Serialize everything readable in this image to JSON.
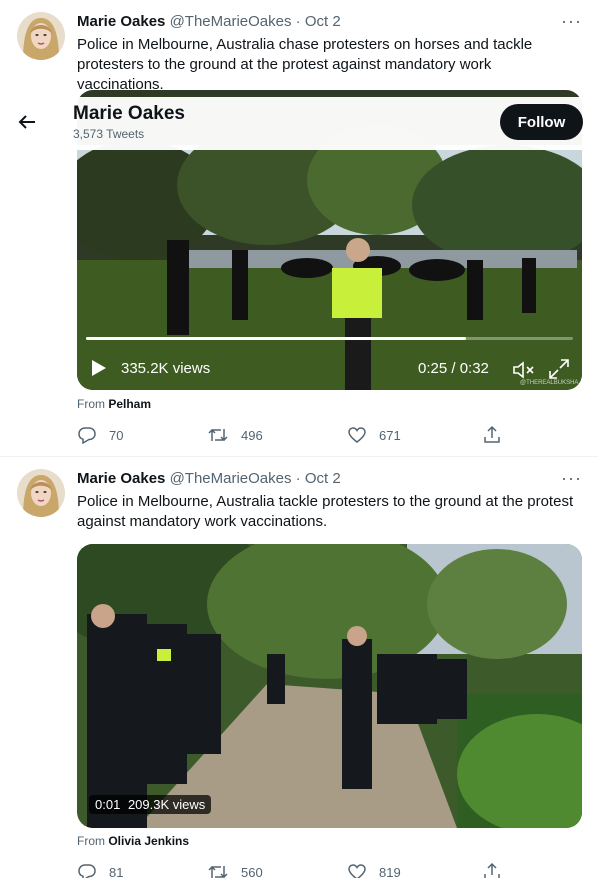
{
  "header": {
    "title": "Marie Oakes",
    "tweet_count": "3,573 Tweets",
    "follow_label": "Follow"
  },
  "tweets": [
    {
      "name": "Marie Oakes",
      "handle": "@TheMarieOakes",
      "separator": "·",
      "date": "Oct 2",
      "more": "···",
      "text": "Police in Melbourne, Australia chase protesters on horses and tackle protesters to the ground at the protest against mandatory work vaccinations.",
      "video": {
        "views": "335.2K views",
        "time": "0:25 / 0:32",
        "progress": 0.78,
        "watermark": "@THEREALBUKSHA"
      },
      "from_label": "From",
      "from_source": "Pelham",
      "replies": "70",
      "retweets": "496",
      "likes": "671"
    },
    {
      "name": "Marie Oakes",
      "handle": "@TheMarieOakes",
      "separator": "·",
      "date": "Oct 2",
      "more": "···",
      "text": "Police in Melbourne, Australia tackle protesters to the ground at the protest against mandatory work vaccinations.",
      "video": {
        "elapsed": "0:01",
        "views": "209.3K views"
      },
      "from_label": "From",
      "from_source": "Olivia Jenkins",
      "replies": "81",
      "retweets": "560",
      "likes": "819"
    }
  ],
  "colors": {
    "text_primary": "#0f1419",
    "text_secondary": "#536471",
    "follow_bg": "#0f1419",
    "divider": "#eff3f4",
    "hi_vis": "#c8f03a"
  }
}
